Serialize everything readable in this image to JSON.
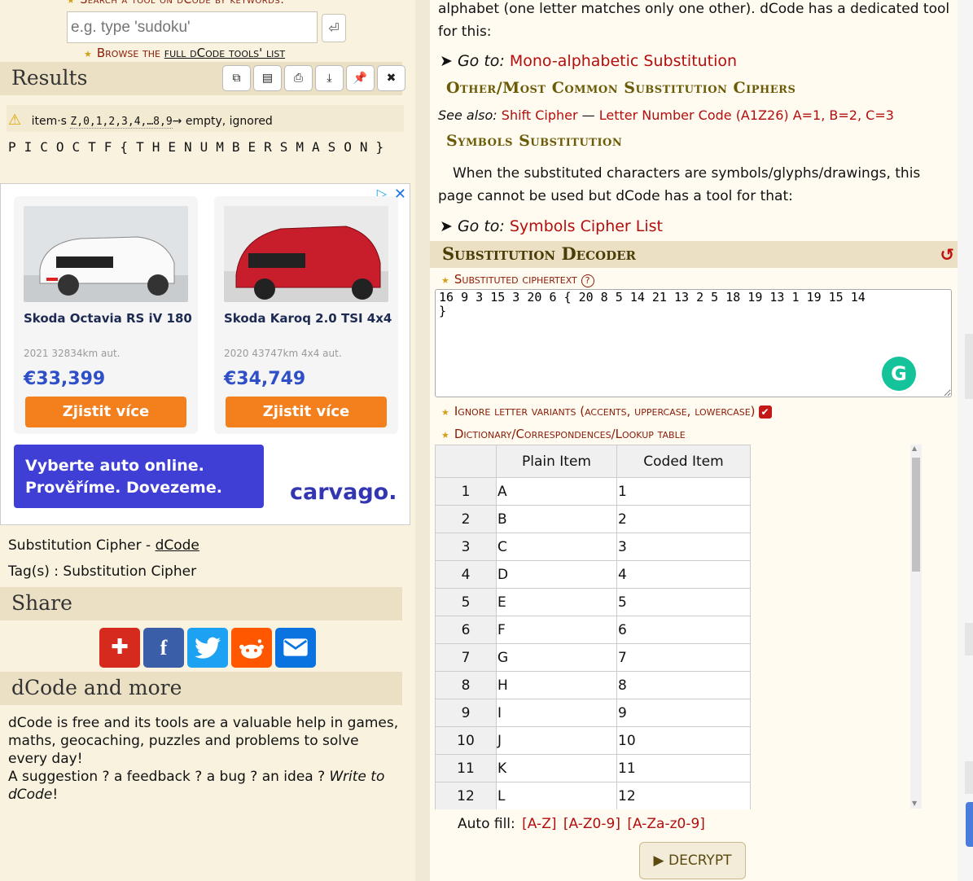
{
  "search": {
    "title": "Search a tool on dCode by keywords:",
    "placeholder": "e.g. type 'sudoku'",
    "go_icon": "⏎",
    "browse_prefix": "Browse the ",
    "browse_link": "full dCode tools' list"
  },
  "results": {
    "heading": "Results",
    "tools": [
      "⧉",
      "▤",
      "⎙",
      "⤓",
      "📌",
      "✖"
    ],
    "warning_prefix": "item·s",
    "warning_items": "Z,0,1,2,3,4,…8,9",
    "warning_suffix": "→ empty, ignored",
    "output": "PICOCTF{THENUMBERSMASON}"
  },
  "ad": {
    "cars": [
      {
        "name": "Skoda Octavia RS iV 180",
        "meta": "2021 32834km aut.",
        "price": "€33,399",
        "button": "Zjistit více"
      },
      {
        "name": "Skoda Karoq 2.0 TSI 4x4",
        "meta": "2020 43747km 4x4 aut.",
        "price": "€34,749",
        "button": "Zjistit více"
      }
    ],
    "banner_line1": "Vyberte auto online.",
    "banner_line2": "Prověříme. Dovezeme.",
    "brand": "carvago."
  },
  "page_info": {
    "title_prefix": "Substitution Cipher - ",
    "title_link": "dCode",
    "tags": "Tag(s) : Substitution Cipher"
  },
  "share": {
    "heading": "Share"
  },
  "more": {
    "heading": "dCode and more",
    "text1": "dCode is free and its tools are a valuable help in games, maths, geocaching, puzzles and problems to solve every day!",
    "text2": "A suggestion ? a feedback ? a bug ? an idea ? ",
    "text_link": "Write to dCode",
    "text_end": "!"
  },
  "article": {
    "intro_line1": "alphabet (one letter matches only one other). dCode has a dedicated tool",
    "intro_line2": "for this:",
    "goto_label": "➤ Go to: ",
    "goto1": "Mono-alphabetic Substitution",
    "heading_other": "Other/Most Common Substitution Ciphers",
    "seealso_label": "See also: ",
    "seealso1": "Shift Cipher",
    "seealso_sep": " — ",
    "seealso2": "Letter Number Code (A1Z26) A=1, B=2, C=3",
    "heading_symbols": "Symbols Substitution",
    "symbols_line1": "When the substituted characters are symbols/glyphs/drawings, this",
    "symbols_line2": "page cannot be used but dCode has a tool for that:",
    "goto2": "Symbols Cipher List"
  },
  "decoder": {
    "heading": "Substitution Decoder",
    "reload_icon": "↺",
    "ciphertext_label": "Substituted ciphertext",
    "ciphertext": "16 9 3 15 3 20 6 { 20 8 5 14 21 13 2 5 18 19 13 1 19 15 14\n}",
    "ignore_label": "Ignore letter variants (accents, uppercase, lowercase)",
    "ignore_checked": true,
    "dict_label": "Dictionary/Correspondences/Lookup table",
    "table_headers": [
      "",
      "Plain Item",
      "Coded Item"
    ],
    "table_rows": [
      [
        "1",
        "A",
        "1"
      ],
      [
        "2",
        "B",
        "2"
      ],
      [
        "3",
        "C",
        "3"
      ],
      [
        "4",
        "D",
        "4"
      ],
      [
        "5",
        "E",
        "5"
      ],
      [
        "6",
        "F",
        "6"
      ],
      [
        "7",
        "G",
        "7"
      ],
      [
        "8",
        "H",
        "8"
      ],
      [
        "9",
        "I",
        "9"
      ],
      [
        "10",
        "J",
        "10"
      ],
      [
        "11",
        "K",
        "11"
      ],
      [
        "12",
        "L",
        "12"
      ]
    ],
    "autofill_label": "Auto fill:",
    "autofill_options": [
      "[A-Z]",
      "[A-Z0-9]",
      "[A-Za-z0-9]"
    ],
    "decrypt": "▶ DECRYPT"
  },
  "colors": {
    "accent": "#b30d0d",
    "heading_bg": "#ebe0c4",
    "panel_bg": "#f8f2df"
  }
}
